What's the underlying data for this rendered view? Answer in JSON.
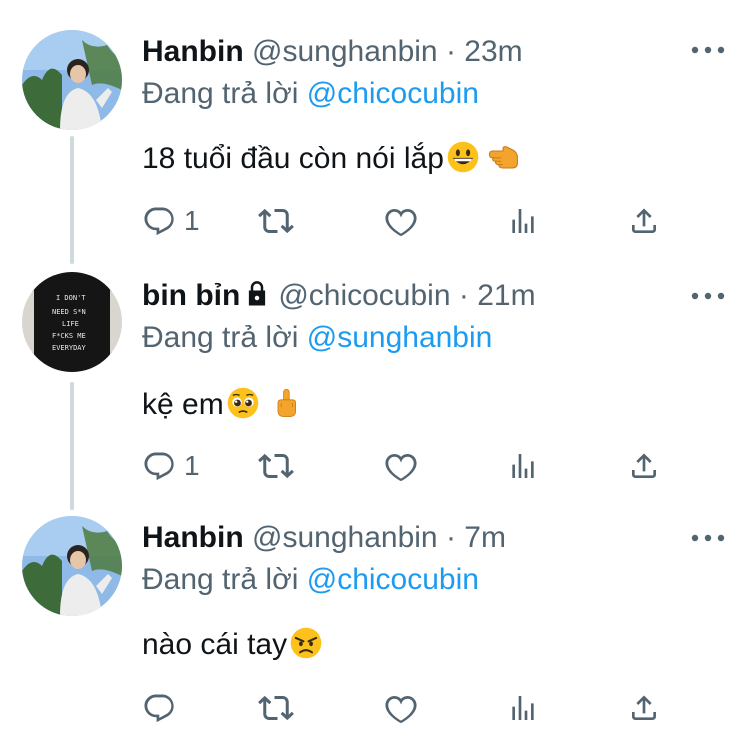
{
  "tweets": [
    {
      "name": "Hanbin",
      "handle": "@sunghanbin",
      "time": "· 23m",
      "replying_prefix": "Đang trả lời",
      "replying_to": "@chicocubin",
      "text": "18 tuổi đầu còn nói lắp",
      "emojis": [
        "grinning-face-emoji",
        "backhand-pointing-left-emoji"
      ],
      "reply_count": "1",
      "locked": false
    },
    {
      "name": "bin bỉn",
      "handle": "@chicocubin",
      "time": "· 21m",
      "replying_prefix": "Đang trả lời",
      "replying_to": "@sunghanbin",
      "text": "kệ em",
      "emojis": [
        "pleading-face-emoji",
        "middle-finger-emoji"
      ],
      "reply_count": "1",
      "locked": true,
      "avatar_shirt_text": [
        "I DON'T",
        "NEED S*N",
        "LIFE",
        "F*CKS ME",
        "EVERYDAY"
      ]
    },
    {
      "name": "Hanbin",
      "handle": "@sunghanbin",
      "time": "· 7m",
      "replying_prefix": "Đang trả lời",
      "replying_to": "@chicocubin",
      "text": "nào cái tay",
      "emojis": [
        "angry-face-emoji"
      ],
      "reply_count": "",
      "locked": false
    }
  ],
  "icons": {
    "reply": "reply-icon",
    "retweet": "retweet-icon",
    "like": "heart-icon",
    "analytics": "analytics-icon",
    "share": "share-icon",
    "more": "more-icon",
    "lock": "lock-icon"
  },
  "colors": {
    "text": "#0f1419",
    "secondary": "#536471",
    "mention": "#1d9bf0",
    "thread_line": "#cfd9de"
  }
}
